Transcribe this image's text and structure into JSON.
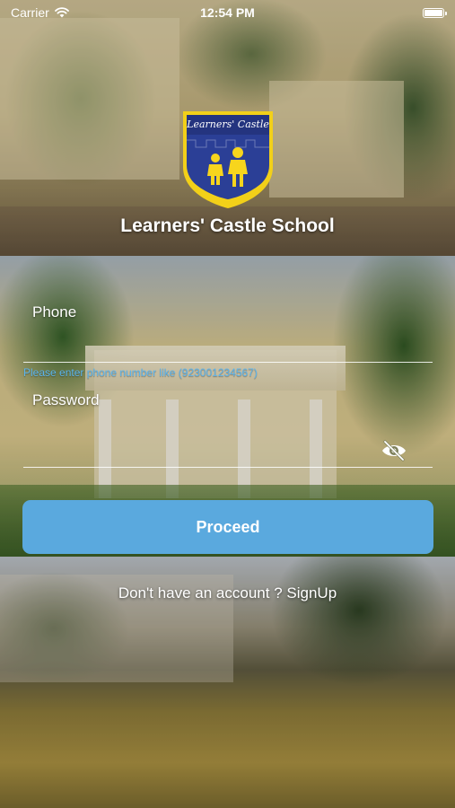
{
  "status_bar": {
    "carrier": "Carrier",
    "time": "12:54 PM",
    "icons": [
      "wifi-icon",
      "battery-icon"
    ]
  },
  "logo": {
    "text": "Learners' Castle",
    "colors": {
      "shield_blue": "#2b3f96",
      "shield_yellow": "#f2d019",
      "kids_yellow": "#f7d51d"
    }
  },
  "school_name": "Learners' Castle School",
  "form": {
    "phone_label": "Phone",
    "phone_value": "",
    "phone_hint": "Please enter phone number like (923001234567)",
    "password_label": "Password",
    "password_value": "",
    "password_toggle_icon": "eye-slash-icon",
    "proceed_label": "Proceed"
  },
  "signup": {
    "prompt": "Don't have an account ?",
    "link": "SignUp"
  },
  "colors": {
    "accent": "#5aa9de",
    "hint_text": "#5ab4ee",
    "text": "#ffffff"
  }
}
